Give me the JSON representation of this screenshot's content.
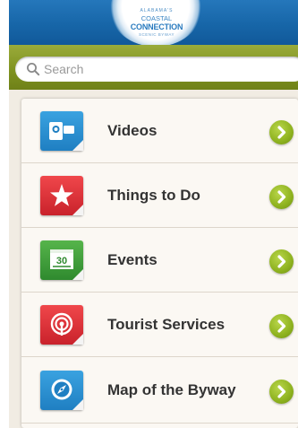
{
  "header": {
    "logo": {
      "line1": "ALABAMA'S",
      "line2": "COASTAL",
      "line3": "CONNECTION",
      "line4": "SCENIC BYWAY"
    }
  },
  "search": {
    "placeholder": "Search",
    "value": ""
  },
  "menu": {
    "items": [
      {
        "label": "Videos",
        "icon": "video-camera-icon",
        "color": "#2a8fd0"
      },
      {
        "label": "Things to Do",
        "icon": "star-icon",
        "color": "#e0323a"
      },
      {
        "label": "Events",
        "icon": "calendar-icon",
        "calendar_day": "30",
        "color": "#3f9e3a"
      },
      {
        "label": "Tourist Services",
        "icon": "broadcast-icon",
        "color": "#e0323a"
      },
      {
        "label": "Map of the Byway",
        "icon": "compass-icon",
        "color": "#2a8fd0"
      }
    ]
  },
  "colors": {
    "header_blue": "#1766a8",
    "search_bar_green": "#7e9120",
    "go_button_green": "#8eb21f",
    "label_text": "#333333"
  }
}
